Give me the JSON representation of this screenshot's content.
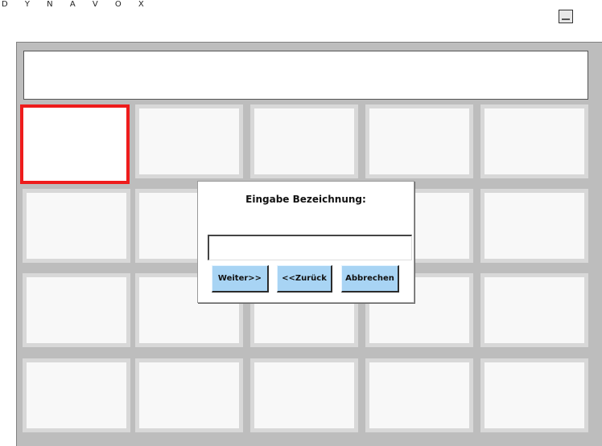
{
  "app": {
    "brand": "D Y N A V O X"
  },
  "dialog": {
    "title": "Eingabe Bezeichnung:",
    "input_value": "",
    "buttons": {
      "next": "Weiter>>",
      "back": "<<Zurück",
      "cancel": "Abbrechen"
    }
  },
  "colors": {
    "selection": "#ee1c1c",
    "button": "#a8d4f4",
    "panel": "#bdbdbd"
  }
}
